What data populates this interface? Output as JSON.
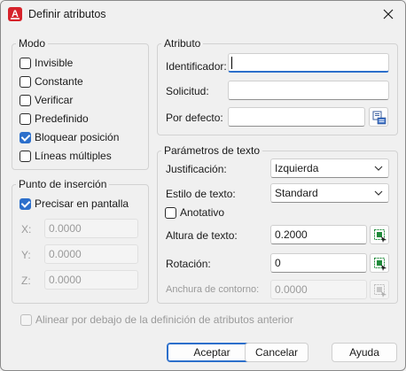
{
  "window": {
    "title": "Definir atributos",
    "app_icon_letter": "A"
  },
  "modo": {
    "legend": "Modo",
    "options": [
      {
        "label": "Invisible",
        "checked": false
      },
      {
        "label": "Constante",
        "checked": false
      },
      {
        "label": "Verificar",
        "checked": false
      },
      {
        "label": "Predefinido",
        "checked": false
      },
      {
        "label": "Bloquear posición",
        "checked": true
      },
      {
        "label": "Líneas múltiples",
        "checked": false
      }
    ]
  },
  "atributo": {
    "legend": "Atributo",
    "identificador_label": "Identificador:",
    "identificador_value": "",
    "solicitud_label": "Solicitud:",
    "solicitud_value": "",
    "por_defecto_label": "Por defecto:",
    "por_defecto_value": ""
  },
  "punto_insercion": {
    "legend": "Punto de inserción",
    "precisar_label": "Precisar en pantalla",
    "precisar_checked": true,
    "x_label": "X:",
    "x_value": "0.0000",
    "y_label": "Y:",
    "y_value": "0.0000",
    "z_label": "Z:",
    "z_value": "0.0000"
  },
  "parametros_texto": {
    "legend": "Parámetros de texto",
    "justificacion_label": "Justificación:",
    "justificacion_value": "Izquierda",
    "estilo_label": "Estilo de texto:",
    "estilo_value": "Standard",
    "anotativo_label": "Anotativo",
    "anotativo_checked": false,
    "altura_label": "Altura de texto:",
    "altura_value": "0.2000",
    "rotacion_label": "Rotación:",
    "rotacion_value": "0",
    "anchura_label": "Anchura de contorno:",
    "anchura_value": "0.0000"
  },
  "alinear": {
    "label": "Alinear por debajo de la definición de atributos anterior",
    "checked": false
  },
  "buttons": {
    "aceptar": "Aceptar",
    "cancelar": "Cancelar",
    "ayuda": "Ayuda"
  },
  "colors": {
    "accent": "#2c6fcb",
    "app_icon": "#d6232b",
    "pick_icon_green": "#1f8a3a"
  }
}
